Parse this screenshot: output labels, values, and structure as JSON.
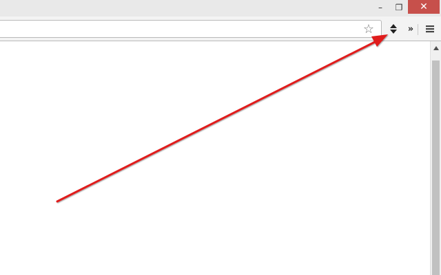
{
  "window_controls": {
    "minimize_glyph": "–",
    "maximize_glyph": "❐",
    "close_glyph": "✕",
    "close_color": "#c7504b"
  },
  "toolbar": {
    "bookmark_star_glyph": "☆",
    "extensions_overflow_glyph": "»",
    "icons": {
      "star": "star-icon",
      "extension": "sort-arrows-icon",
      "overflow": "chevron-double-right-icon",
      "menu": "hamburger-menu-icon"
    }
  },
  "annotation": {
    "color": "#e01b1b",
    "target": "extension-button"
  }
}
